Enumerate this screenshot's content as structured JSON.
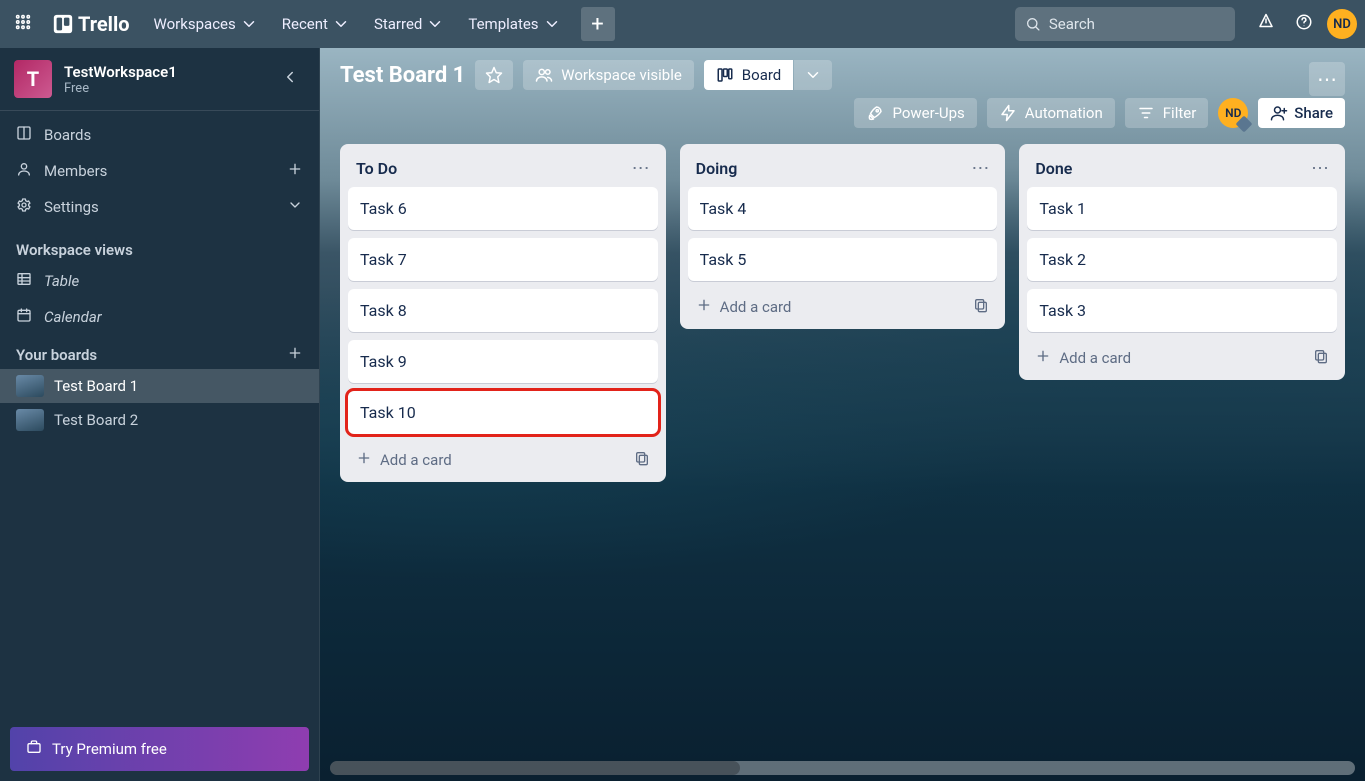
{
  "header": {
    "logo": "Trello",
    "menus": [
      "Workspaces",
      "Recent",
      "Starred",
      "Templates"
    ],
    "search_placeholder": "Search",
    "avatar_initials": "ND"
  },
  "sidebar": {
    "workspace_initial": "T",
    "workspace_name": "TestWorkspace1",
    "workspace_plan": "Free",
    "nav": {
      "boards": "Boards",
      "members": "Members",
      "settings": "Settings"
    },
    "views_title": "Workspace views",
    "views": {
      "table": "Table",
      "calendar": "Calendar"
    },
    "your_boards_title": "Your boards",
    "boards": [
      {
        "name": "Test Board 1",
        "active": true
      },
      {
        "name": "Test Board 2",
        "active": false
      }
    ],
    "premium_cta": "Try Premium free"
  },
  "board": {
    "title": "Test Board 1",
    "visibility": "Workspace visible",
    "view_label": "Board",
    "powerups": "Power-Ups",
    "automation": "Automation",
    "filter": "Filter",
    "share": "Share",
    "member_initials": "ND"
  },
  "lists": [
    {
      "title": "To Do",
      "cards": [
        "Task 6",
        "Task 7",
        "Task 8",
        "Task 9",
        "Task 10"
      ],
      "highlighted_index": 4,
      "add_label": "Add a card"
    },
    {
      "title": "Doing",
      "cards": [
        "Task 4",
        "Task 5"
      ],
      "highlighted_index": -1,
      "add_label": "Add a card"
    },
    {
      "title": "Done",
      "cards": [
        "Task 1",
        "Task 2",
        "Task 3"
      ],
      "highlighted_index": -1,
      "add_label": "Add a card"
    }
  ]
}
